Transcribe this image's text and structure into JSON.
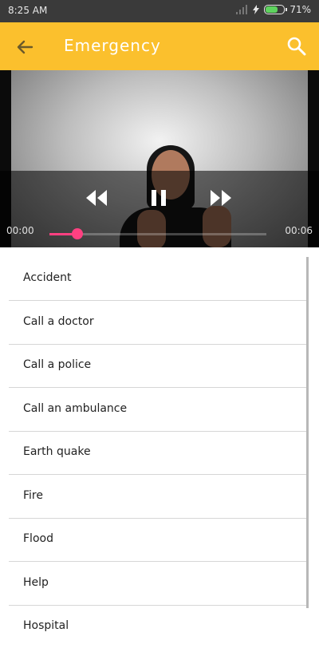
{
  "status_bar": {
    "time": "8:25 AM",
    "battery_percent_label": "71%",
    "battery_level": 0.71,
    "icons": [
      "signal-icon",
      "charging-icon",
      "battery-icon"
    ]
  },
  "toolbar": {
    "title": "Emergency",
    "back_icon": "back-arrow-icon",
    "search_icon": "search-icon",
    "color": "#fbc02d"
  },
  "video": {
    "current_time": "00:00",
    "duration": "00:06",
    "progress": 0.13,
    "controls": [
      "rewind-icon",
      "pause-icon",
      "fast-forward-icon"
    ],
    "accent": "#ff4081"
  },
  "list": {
    "items": [
      {
        "label": "Accident"
      },
      {
        "label": "Call a doctor"
      },
      {
        "label": "Call a police"
      },
      {
        "label": "Call an ambulance"
      },
      {
        "label": "Earth quake"
      },
      {
        "label": "Fire"
      },
      {
        "label": "Flood"
      },
      {
        "label": "Help"
      },
      {
        "label": "Hospital"
      }
    ]
  }
}
